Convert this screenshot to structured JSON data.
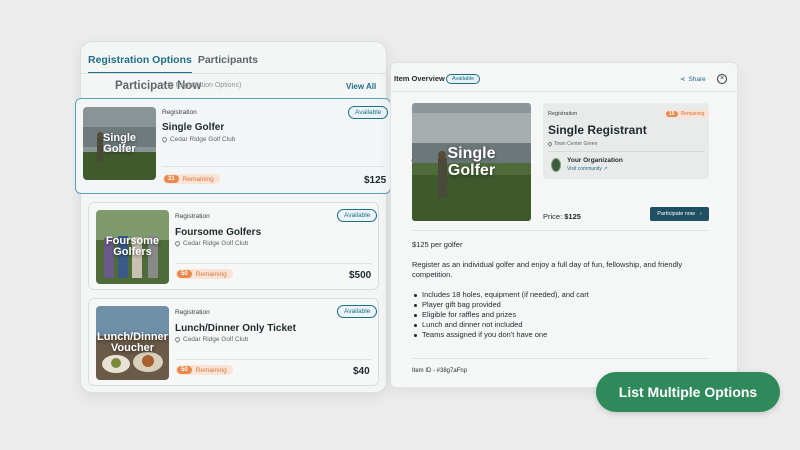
{
  "tabs": [
    {
      "label": "Registration Options",
      "active": true
    },
    {
      "label": "Participants",
      "active": false
    }
  ],
  "list_header": {
    "title": "Participate Now",
    "count": "• (5 Registration Options)",
    "view_all": "View All"
  },
  "cards": [
    {
      "type": "Registration",
      "title": "Single Golfer",
      "thumb_text": "Single\nGolfer",
      "location": "Cedar Ridge Golf Club",
      "status": "Available",
      "remaining_count": "31",
      "remaining_label": "Remaining",
      "price": "$125"
    },
    {
      "type": "Registration",
      "title": "Foursome Golfers",
      "thumb_text": "Foursome\nGolfers",
      "location": "Cedar Ridge Golf Club",
      "status": "Available",
      "remaining_count": "50",
      "remaining_label": "Remaining",
      "price": "$500"
    },
    {
      "type": "Registration",
      "title": "Lunch/Dinner Only Ticket",
      "thumb_text": "Lunch/Dinner\nVoucher",
      "location": "Cedar Ridge Golf Club",
      "status": "Available",
      "remaining_count": "50",
      "remaining_label": "Remaining",
      "price": "$40"
    }
  ],
  "overview": {
    "title": "Item Overview",
    "badge": "Available",
    "share": "Share",
    "close": "×",
    "hero_text": "Single\nGolfer",
    "price_label": "Price:",
    "price_value": "$125",
    "info": {
      "type": "Registration",
      "remaining_count": "15",
      "remaining_label": "Remaining",
      "title": "Single Registrant",
      "location": "Town Center Green",
      "org_name": "Your Organization",
      "org_link": "Visit community ↗"
    },
    "participate_button": "Participate now",
    "per_golfer": "$125 per golfer",
    "description": "Register as an individual golfer and enjoy a full day of fun, fellowship, and friendly competition.",
    "bullets": [
      "Includes 18 holes, equipment (if needed), and cart",
      "Player gift bag provided",
      "Eligible for raffles and prizes",
      "Lunch and dinner not included",
      "Teams assigned if you don't have one"
    ],
    "item_id": "Item ID - #38g7aFnp"
  },
  "cta": "List Multiple Options",
  "colors": {
    "accent": "#1f6f88",
    "orange": "#e88a4e",
    "cta_green": "#2f8a5b"
  }
}
